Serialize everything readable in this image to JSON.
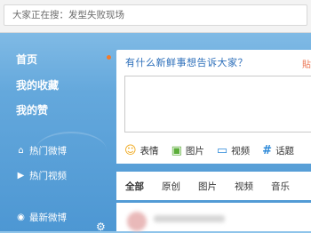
{
  "search": {
    "placeholder": "大家正在搜：发型失败现场"
  },
  "nav": {
    "items": [
      {
        "label": "首页"
      },
      {
        "label": "我的收藏"
      },
      {
        "label": "我的赞"
      }
    ],
    "sub_items": [
      {
        "label": "热门微博",
        "icon": "fire-icon"
      },
      {
        "label": "热门视频",
        "icon": "play-icon"
      },
      {
        "label": "最新微博",
        "icon": "radio-icon"
      }
    ]
  },
  "compose": {
    "title": "有什么新鲜事想告诉大家？",
    "side_text": "貼",
    "tools": [
      {
        "label": "表情",
        "icon": "smile-icon"
      },
      {
        "label": "图片",
        "icon": "image-icon"
      },
      {
        "label": "视频",
        "icon": "video-icon"
      },
      {
        "label": "话题",
        "icon": "hashtag-icon"
      }
    ]
  },
  "tabs": [
    {
      "label": "全部",
      "active": true
    },
    {
      "label": "原创",
      "active": false
    },
    {
      "label": "图片",
      "active": false
    },
    {
      "label": "视频",
      "active": false
    },
    {
      "label": "音乐",
      "active": false
    }
  ]
}
